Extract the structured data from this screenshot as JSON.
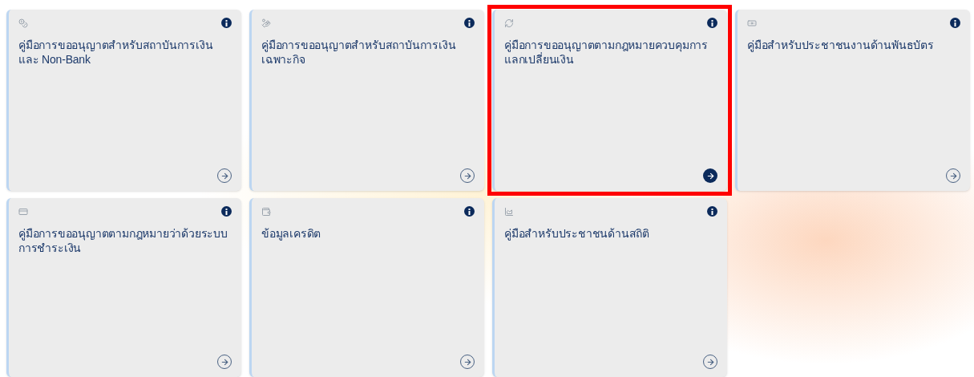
{
  "cards": [
    {
      "title": "คู่มือการขออนุญาตสำหรับสถาบันการเงิน และ Non-Bank",
      "selected": false
    },
    {
      "title": "คู่มือการขออนุญาตสำหรับสถาบันการเงินเฉพาะกิจ",
      "selected": false
    },
    {
      "title": "คู่มือการขออนุญาตตามกฎหมายควบคุมการแลกเปลี่ยนเงิน",
      "selected": true
    },
    {
      "title": "คู่มือสำหรับประชาชนงานด้านพันธบัตร",
      "selected": false
    },
    {
      "title": "คู่มือการขออนุญาตตามกฎหมายว่าด้วยระบบการชำระเงิน",
      "selected": false
    },
    {
      "title": "ข้อมูลเครดิต",
      "selected": false
    },
    {
      "title": "คู่มือสำหรับประชาชนด้านสถิติ",
      "selected": false
    }
  ]
}
